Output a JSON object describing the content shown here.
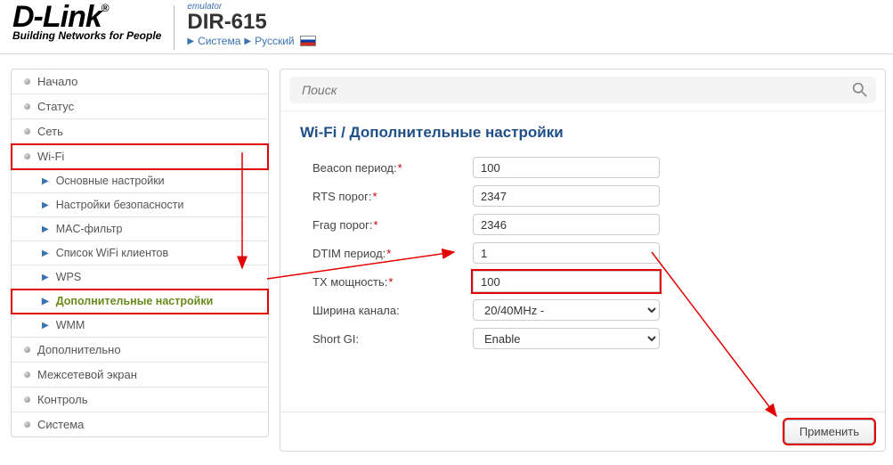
{
  "header": {
    "logo_main": "D-Link",
    "logo_sub": "Building Networks for People",
    "emulator": "emulator",
    "model": "DIR-615",
    "breadcrumb": {
      "system": "Система",
      "language": "Русский"
    }
  },
  "sidebar": {
    "items": [
      {
        "label": "Начало"
      },
      {
        "label": "Статус"
      },
      {
        "label": "Сеть"
      },
      {
        "label": "Wi-Fi",
        "expanded": true,
        "children": [
          {
            "label": "Основные настройки"
          },
          {
            "label": "Настройки безопасности"
          },
          {
            "label": "MAC-фильтр"
          },
          {
            "label": "Список WiFi клиентов"
          },
          {
            "label": "WPS"
          },
          {
            "label": "Дополнительные настройки",
            "active": true
          },
          {
            "label": "WMM"
          }
        ]
      },
      {
        "label": "Дополнительно"
      },
      {
        "label": "Межсетевой экран"
      },
      {
        "label": "Контроль"
      },
      {
        "label": "Система"
      }
    ]
  },
  "search": {
    "placeholder": "Поиск"
  },
  "page": {
    "title": "Wi-Fi /  Дополнительные настройки",
    "fields": {
      "beacon": {
        "label": "Beacon период:",
        "value": "100",
        "required": true
      },
      "rts": {
        "label": "RTS порог:",
        "value": "2347",
        "required": true
      },
      "frag": {
        "label": "Frag порог:",
        "value": "2346",
        "required": true
      },
      "dtim": {
        "label": "DTIM период:",
        "value": "1",
        "required": true
      },
      "txpower": {
        "label": "TX мощность:",
        "value": "100",
        "required": true
      },
      "width": {
        "label": "Ширина канала:",
        "value": "20/40MHz -",
        "required": false
      },
      "shortgi": {
        "label": "Short GI:",
        "value": "Enable",
        "required": false
      }
    },
    "apply_label": "Применить"
  }
}
